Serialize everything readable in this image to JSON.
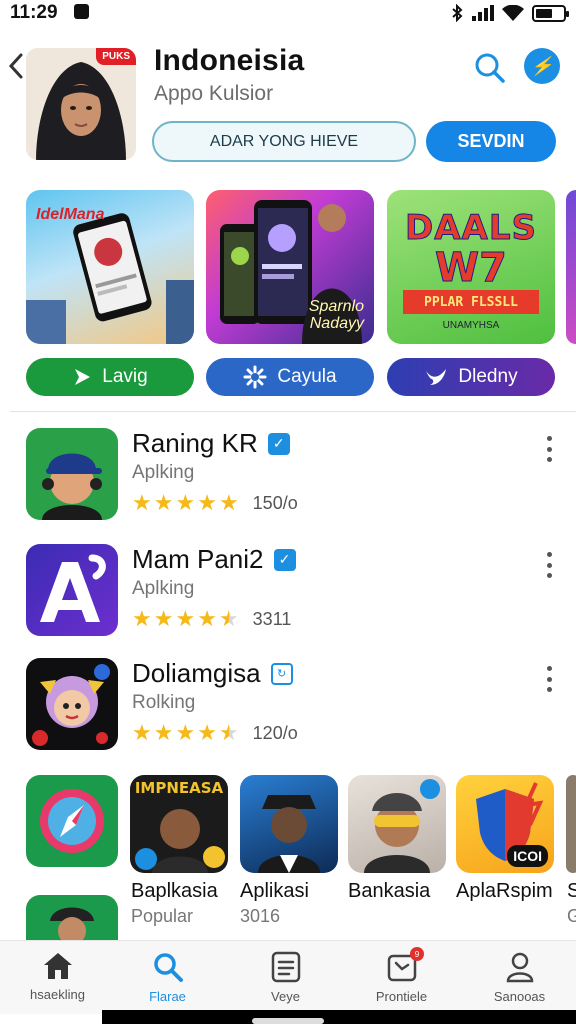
{
  "status_bar": {
    "time": "11:29",
    "battery_level": 0.6
  },
  "header": {
    "app_title": "Indoneisia",
    "app_subtitle": "Appo Kulsior",
    "icon_badge": "PUKS",
    "outline_button": "ADAR YONG HIEVE",
    "primary_button": "SEVDIN"
  },
  "featured": {
    "cards": [
      {
        "overlay": "IdelMana"
      },
      {
        "overlay": "Sparnlo Nadayy"
      },
      {
        "title": "DAALS",
        "big": "W7",
        "banner": "PPLAR FLSSLL",
        "note": "UNAMYHSA"
      }
    ],
    "pills": [
      {
        "label": "Lavig",
        "icon": "play-icon"
      },
      {
        "label": "Cayula",
        "icon": "star-burst-icon"
      },
      {
        "label": "Dledny",
        "icon": "bird-icon"
      }
    ]
  },
  "app_list": [
    {
      "name": "Raning KR",
      "category": "Aplking",
      "rating": 5,
      "count": "150/o",
      "badge": "✓"
    },
    {
      "name": "Mam Pani2",
      "category": "Aplking",
      "rating": 4.5,
      "count": "3311",
      "badge": "✓"
    },
    {
      "name": "Doliamgisa",
      "category": "Rolking",
      "rating": 4.5,
      "count": "120/o",
      "badge": "↻"
    }
  ],
  "grid": [
    {
      "label": "",
      "sub": ""
    },
    {
      "label": "Baplkasia",
      "sub": "Popular",
      "banner": "IMPNEASA"
    },
    {
      "label": "Aplikasi",
      "sub": "3016"
    },
    {
      "label": "Bankasia",
      "sub": ""
    },
    {
      "label": "AplaRspim",
      "sub": "",
      "tag": "ICOI"
    },
    {
      "label": "S",
      "sub": "G"
    }
  ],
  "bottom_nav": [
    {
      "label": "hsaekling",
      "icon": "home-icon"
    },
    {
      "label": "Flarae",
      "icon": "search-icon",
      "active": true
    },
    {
      "label": "Veye",
      "icon": "list-icon"
    },
    {
      "label": "Prontiele",
      "icon": "updates-icon",
      "badge": "9"
    },
    {
      "label": "Sanooas",
      "icon": "profile-icon"
    }
  ],
  "colors": {
    "accent": "#1585e6",
    "star": "#f6b91a",
    "green": "#1a9a3d"
  }
}
